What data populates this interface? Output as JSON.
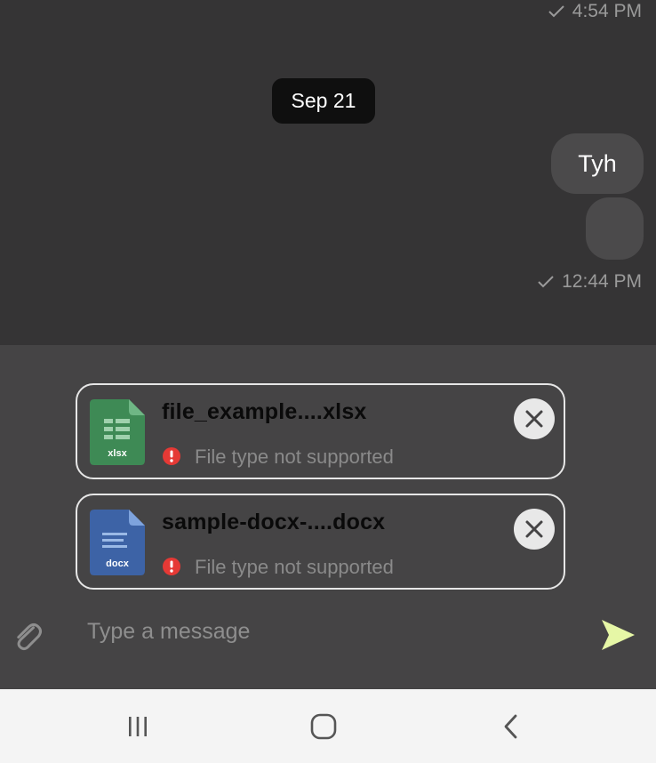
{
  "chat": {
    "top_timestamp": "4:54 PM",
    "date_separator": "Sep 21",
    "messages": [
      {
        "text": "Tyh"
      },
      {
        "text": ""
      }
    ],
    "last_timestamp": "12:44 PM"
  },
  "attachments": [
    {
      "name": "file_example....xlsx",
      "type_label": "xlsx",
      "icon": "spreadsheet-file-icon",
      "color": "#3e8a55",
      "error": "File type not supported"
    },
    {
      "name": "sample-docx-....docx",
      "type_label": "docx",
      "icon": "document-file-icon",
      "color": "#3d63a6",
      "error": "File type not supported"
    }
  ],
  "composer": {
    "placeholder": "Type a message",
    "send_color": "#e6f7a6"
  },
  "colors": {
    "chat_bg": "#353435",
    "composer_bg": "#454445",
    "error_red": "#e53935"
  }
}
